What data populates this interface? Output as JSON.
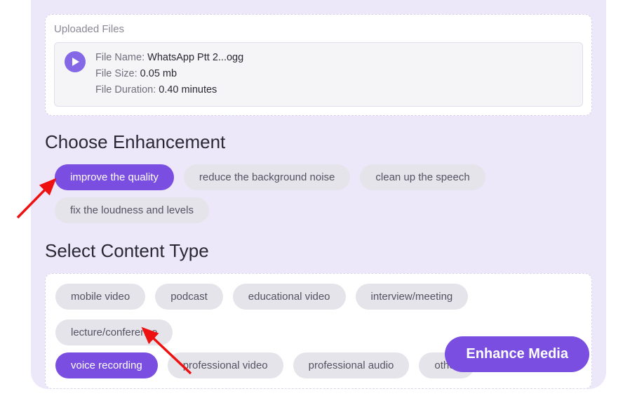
{
  "upload": {
    "section_title": "Uploaded Files",
    "file_name_label": "File Name: ",
    "file_name_value": "WhatsApp Ptt 2...ogg",
    "file_size_label": "File Size: ",
    "file_size_value": "0.05 mb",
    "file_duration_label": "File Duration: ",
    "file_duration_value": "0.40 minutes"
  },
  "enhancement": {
    "title": "Choose Enhancement",
    "options": {
      "improve": "improve the quality",
      "reduce": "reduce the background noise",
      "clean": "clean up the speech",
      "loudness": "fix the loudness and levels"
    }
  },
  "content_type": {
    "title": "Select Content Type",
    "options": {
      "mobile": "mobile video",
      "podcast": "podcast",
      "educational": "educational video",
      "interview": "interview/meeting",
      "lecture": "lecture/conference",
      "voice": "voice recording",
      "pro_video": "professional video",
      "pro_audio": "professional audio",
      "other": "other"
    }
  },
  "enhance_button": "Enhance Media"
}
